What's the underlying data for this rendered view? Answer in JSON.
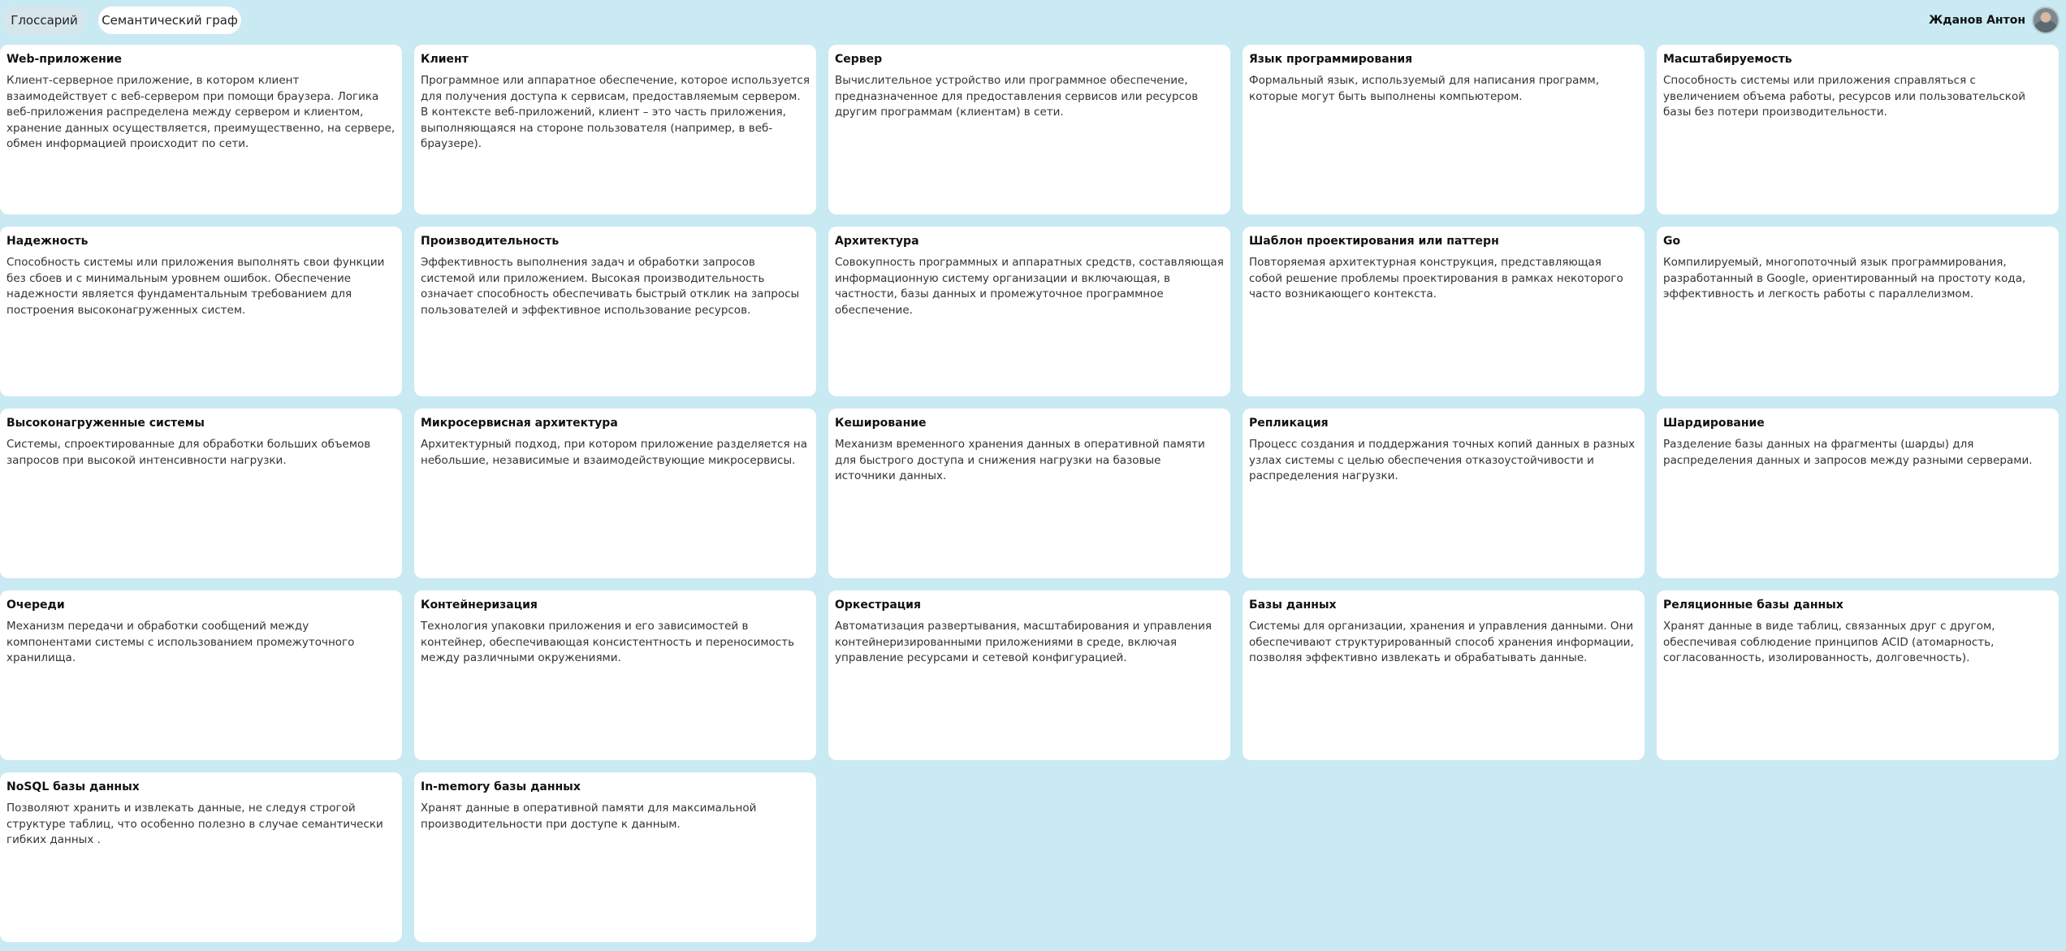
{
  "tabs": [
    {
      "label": "Глоссарий",
      "active": true
    },
    {
      "label": "Семантический граф",
      "active": false
    }
  ],
  "user": {
    "name": "Жданов Антон",
    "avatar_icon": "user-avatar"
  },
  "cards": [
    {
      "title": "Web-приложение",
      "text": "Клиент-серверное приложение, в котором клиент взаимодействует с веб-сервером при помощи браузера. Логика веб-приложения распределена между сервером и клиентом, хранение данных осуществляется, преимущественно, на сервере, обмен информацией происходит по сети."
    },
    {
      "title": "Клиент",
      "text": "Программное или аппаратное обеспечение, которое используется для получения доступа к сервисам, предоставляемым сервером. В контексте веб-приложений, клиент – это часть приложения, выполняющаяся на стороне пользователя (например, в веб-браузере)."
    },
    {
      "title": "Сервер",
      "text": "Вычислительное устройство или программное обеспечение, предназначенное для предоставления сервисов или ресурсов другим программам (клиентам) в сети."
    },
    {
      "title": "Язык программирования",
      "text": "Формальный язык, используемый для написания программ, которые могут быть выполнены компьютером."
    },
    {
      "title": "Масштабируемость",
      "text": "Способность системы или приложения справляться с увеличением объема работы, ресурсов или пользовательской базы без потери производительности."
    },
    {
      "title": "Надежность",
      "text": "Способность системы или приложения выполнять свои функции без сбоев и с минимальным уровнем ошибок. Обеспечение надежности является фундаментальным требованием для построения высоконагруженных систем."
    },
    {
      "title": "Производительность",
      "text": "Эффективность выполнения задач и обработки запросов системой или приложением. Высокая производительность означает способность обеспечивать быстрый отклик на запросы пользователей и эффективное использование ресурсов."
    },
    {
      "title": "Архитектура",
      "text": "Совокупность программных и аппаратных средств, составляющая информационную систему организации и включающая, в частности, базы данных и промежуточное программное обеспечение."
    },
    {
      "title": "Шаблон проектирования или паттерн",
      "text": "Повторяемая архитектурная конструкция, представляющая собой решение проблемы проектирования в рамках некоторого часто возникающего контекста."
    },
    {
      "title": "Go",
      "text": "Компилируемый, многопоточный язык программирования, разработанный в Google, ориентированный на простоту кода, эффективность и легкость работы с параллелизмом."
    },
    {
      "title": "Высоконагруженные системы",
      "text": "Системы, спроектированные для обработки больших объемов запросов при высокой интенсивности нагрузки."
    },
    {
      "title": "Микросервисная архитектура",
      "text": "Архитектурный подход, при котором приложение разделяется на небольшие, независимые и взаимодействующие микросервисы."
    },
    {
      "title": "Кеширование",
      "text": "Механизм временного хранения данных в оперативной памяти для быстрого доступа и снижения нагрузки на базовые источники данных."
    },
    {
      "title": "Репликация",
      "text": "Процесс создания и поддержания точных копий данных в разных узлах системы с целью обеспечения отказоустойчивости и распределения нагрузки."
    },
    {
      "title": "Шардирование",
      "text": "Разделение базы данных на фрагменты (шарды) для распределения данных и запросов между разными серверами."
    },
    {
      "title": "Очереди",
      "text": "Механизм передачи и обработки сообщений между компонентами системы с использованием промежуточного хранилища."
    },
    {
      "title": "Контейнеризация",
      "text": "Технология упаковки приложения и его зависимостей в контейнер, обеспечивающая консистентность и переносимость между различными окружениями."
    },
    {
      "title": "Оркестрация",
      "text": "Автоматизация развертывания, масштабирования и управления контейнеризированными приложениями в среде, включая управление ресурсами и сетевой конфигурацией."
    },
    {
      "title": "Базы данных",
      "text": "Системы для организации, хранения и управления данными. Они обеспечивают структурированный способ хранения информации, позволяя эффективно извлекать и обрабатывать данные."
    },
    {
      "title": "Реляционные базы данных",
      "text": "Хранят данные в виде таблиц, связанных друг с другом, обеспечивая соблюдение принципов ACID (атомарность, согласованность, изолированность, долговечность)."
    },
    {
      "title": "NoSQL базы данных",
      "text": "Позволяют хранить и извлекать данные, не следуя строгой структуре таблиц, что особенно полезно в случае семантически гибких данных ."
    },
    {
      "title": "In-memory базы данных",
      "text": "Хранят данные в оперативной памяти для максимальной производительности при доступе к данным."
    }
  ]
}
